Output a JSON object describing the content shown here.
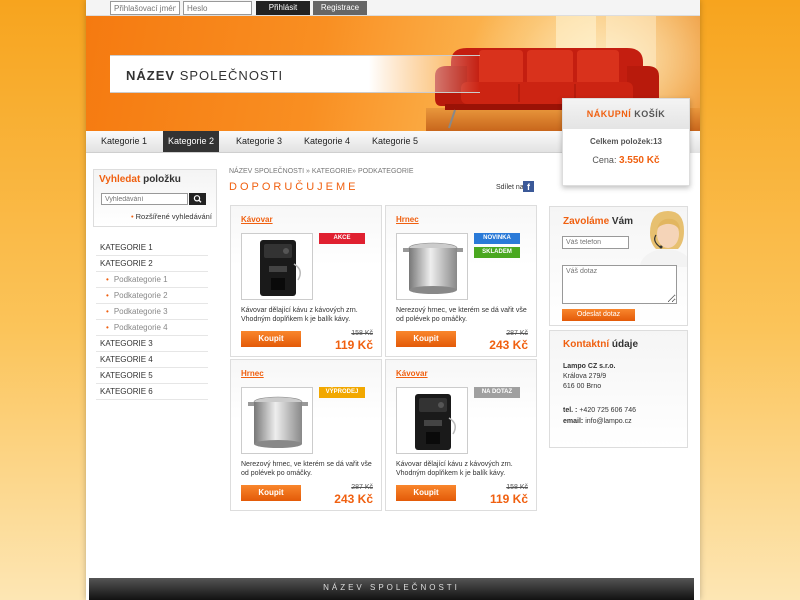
{
  "topbar": {
    "login_placeholder": "Přihlašovací jméno",
    "password_placeholder": "Heslo",
    "login_button": "Přihlásit",
    "register_button": "Registrace"
  },
  "header": {
    "company_bold": "NÁZEV",
    "company_rest": "SPOLEČNOSTI"
  },
  "cart": {
    "title_accent": "NÁKUPNÍ",
    "title_rest": "KOŠÍK",
    "count_label": "Celkem položek:",
    "count_value": "13",
    "price_label": "Cena:",
    "price_value": "3.550 Kč"
  },
  "nav": {
    "items": [
      "Kategorie 1",
      "Kategorie 2",
      "Kategorie 3",
      "Kategorie 4",
      "Kategorie 5"
    ],
    "active_index": 1
  },
  "search": {
    "title_accent": "Vyhledat",
    "title_rest": "položku",
    "placeholder": "Vyhledávání",
    "advanced_link": "Rozšířené vyhledávání"
  },
  "categories": [
    {
      "label": "KATEGORIE 1",
      "sub": false
    },
    {
      "label": "KATEGORIE 2",
      "sub": false
    },
    {
      "label": "Podkategorie 1",
      "sub": true
    },
    {
      "label": "Podkategorie 2",
      "sub": true
    },
    {
      "label": "Podkategorie 3",
      "sub": true
    },
    {
      "label": "Podkategorie 4",
      "sub": true
    },
    {
      "label": "KATEGORIE 3",
      "sub": false
    },
    {
      "label": "KATEGORIE 4",
      "sub": false
    },
    {
      "label": "KATEGORIE 5",
      "sub": false
    },
    {
      "label": "KATEGORIE 6",
      "sub": false
    }
  ],
  "breadcrumb": "NÁZEV SPOLEČNOSTI » KATEGORIE» PODKATEGORIE",
  "page_title": "DOPORUČUJEME",
  "share_label": "Sdílet na",
  "products": [
    {
      "name": "Kávovar",
      "image": "coffee-machine",
      "badges": [
        {
          "label": "AKCE",
          "color": "#e02030"
        }
      ],
      "desc": "Kávovar dělající kávu z kávových zrn. Vhodným doplňkem k je balík kávy.",
      "buy": "Koupit",
      "old_price": "158 Kč",
      "price": "119 Kč"
    },
    {
      "name": "Hrnec",
      "image": "pot",
      "badges": [
        {
          "label": "NOVINKA",
          "color": "#2a7ad8"
        },
        {
          "label": "SKLADEM",
          "color": "#4aa820"
        }
      ],
      "desc": "Nerezový hrnec, ve kterém se dá vařit vše od polévek po omáčky.",
      "buy": "Koupit",
      "old_price": "287 Kč",
      "price": "243 Kč"
    },
    {
      "name": "Hrnec",
      "image": "pot",
      "badges": [
        {
          "label": "VÝPRODEJ",
          "color": "#f2a800"
        }
      ],
      "desc": "Nerezový hrnec, ve kterém se dá vařit vše od polévek po omáčky.",
      "buy": "Koupit",
      "old_price": "287 Kč",
      "price": "243 Kč"
    },
    {
      "name": "Kávovar",
      "image": "coffee-machine",
      "badges": [
        {
          "label": "NA DOTAZ",
          "color": "#a0a0a0"
        }
      ],
      "desc": "Kávovar dělající kávu z kávových zrn. Vhodným doplňkem k je balík kávy.",
      "buy": "Koupit",
      "old_price": "158 Kč",
      "price": "119 Kč"
    }
  ],
  "callback": {
    "title_accent": "Zavoláme",
    "title_rest": "Vám",
    "phone_placeholder": "Váš telefon",
    "message_placeholder": "Váš dotaz",
    "send_button": "Odeslat dotaz"
  },
  "contact": {
    "title_accent": "Kontaktní",
    "title_rest": "údaje",
    "company": "Lampo CZ s.r.o.",
    "street": "Králova 279/9",
    "city": "616 00 Brno",
    "phone_label": "tel. :",
    "phone": "+420 725 606 746",
    "email_label": "email:",
    "email": "info@lampo.cz"
  },
  "footer": "NÁZEV SPOLEČNOSTI",
  "colors": {
    "accent": "#f06010",
    "background": "#f7a41e"
  }
}
